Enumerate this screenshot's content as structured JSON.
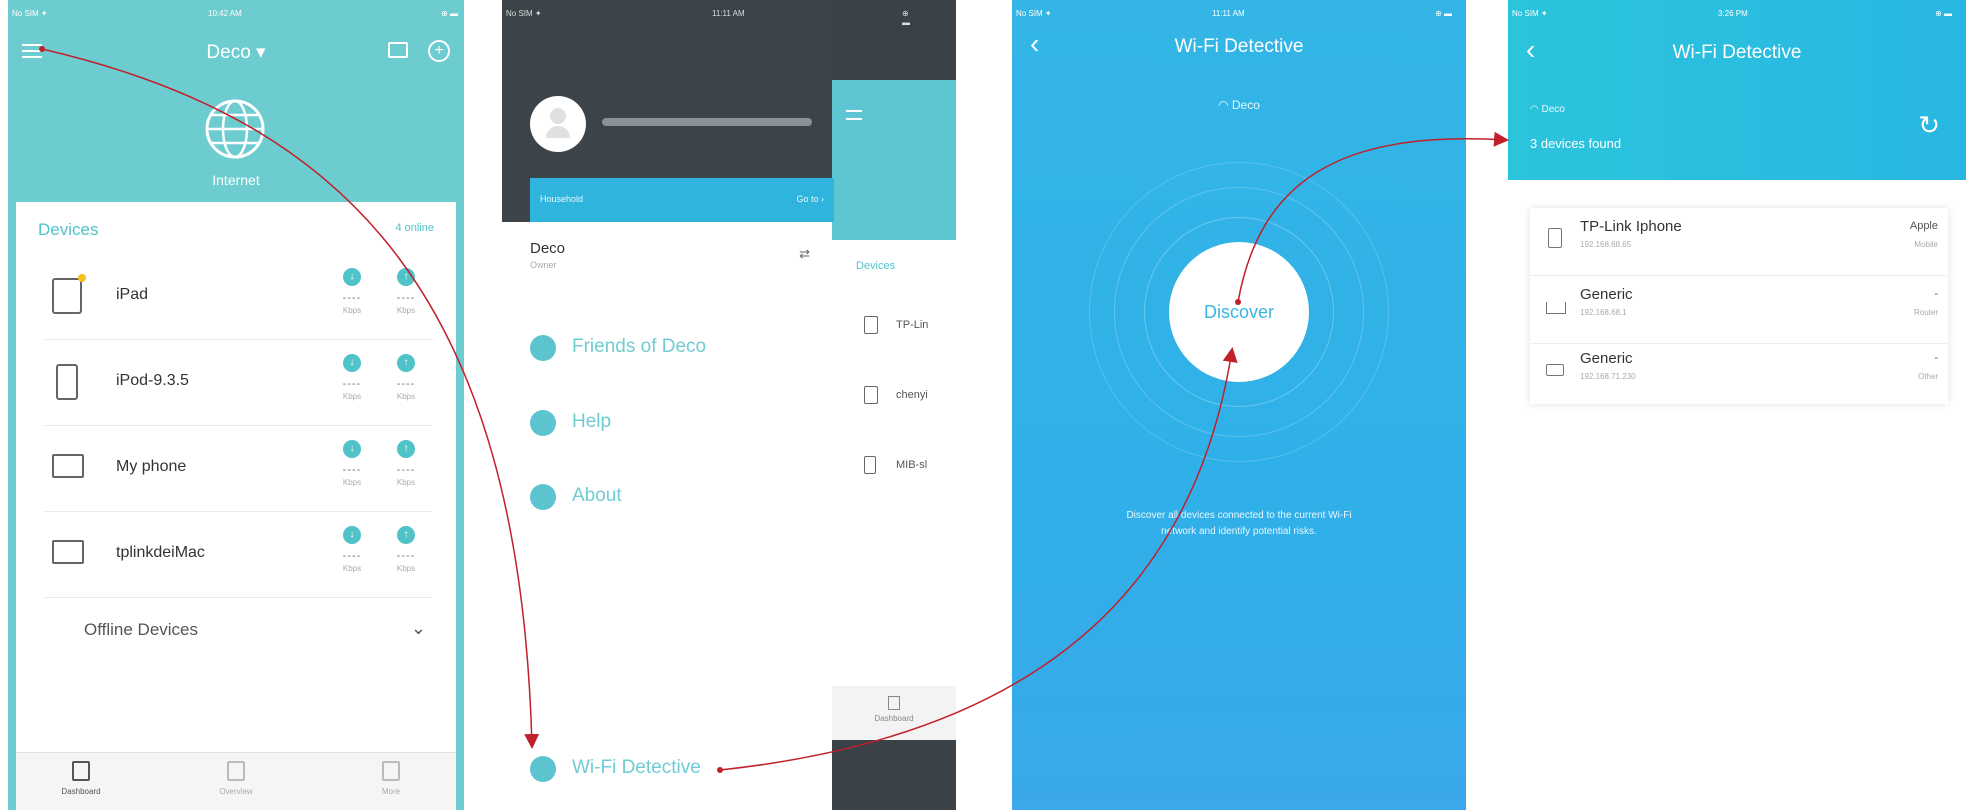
{
  "colors": {
    "teal": "#6cccd0",
    "accent": "#4fc3c8",
    "arrow": "#c0202a",
    "blue": "#2fb0e8"
  },
  "screen1": {
    "status": {
      "carrier": "No SIM ✦",
      "time": "10:42 AM",
      "battery": "⊕ ▬"
    },
    "title": "Deco ▾",
    "internet_label": "Internet",
    "devices_header": "Devices",
    "online_count": "4 online",
    "devices": [
      {
        "name": "iPad",
        "down": "----",
        "up": "----",
        "unit_down": "Kbps",
        "unit_up": "Kbps"
      },
      {
        "name": "iPod-9.3.5",
        "down": "----",
        "up": "----",
        "unit_down": "Kbps",
        "unit_up": "Kbps"
      },
      {
        "name": "My phone",
        "down": "----",
        "up": "----",
        "unit_down": "Kbps",
        "unit_up": "Kbps"
      },
      {
        "name": "tplinkdeiMac",
        "down": "----",
        "up": "----",
        "unit_down": "Kbps",
        "unit_up": "Kbps"
      }
    ],
    "offline_label": "Offline Devices",
    "tabs": [
      "Dashboard",
      "Overview",
      "More"
    ]
  },
  "screen2": {
    "status": {
      "carrier": "No SIM ✦",
      "time": "11:11 AM",
      "battery": "⊕ ▬"
    },
    "household_label": "Household",
    "household_action": "Go to ›",
    "network_name": "Deco",
    "network_role": "Owner",
    "menu": [
      "Friends of Deco",
      "Help",
      "About"
    ],
    "wifi_detective": "Wi-Fi Detective",
    "behind": {
      "devices_label": "Devices",
      "items": [
        "TP-Lin",
        "chenyi",
        "MIB-sl"
      ],
      "tab": "Dashboard"
    }
  },
  "screen3": {
    "status": {
      "carrier": "No SIM ✦",
      "time": "11:11 AM",
      "battery": "⊕ ▬"
    },
    "title": "Wi-Fi Detective",
    "network": "Deco",
    "discover": "Discover",
    "description_line1": "Discover all devices connected to the current Wi-Fi",
    "description_line2": "network and identify potential risks."
  },
  "screen4": {
    "status": {
      "carrier": "No SIM ✦",
      "time": "3:26 PM",
      "battery": "⊕ ▬"
    },
    "title": "Wi-Fi Detective",
    "network": "Deco",
    "found": "3 devices found",
    "devices": [
      {
        "name": "TP-Link Iphone",
        "ip": "192.168.68.65",
        "brand": "Apple",
        "type": "Mobile"
      },
      {
        "name": "Generic",
        "ip": "192.168.68.1",
        "brand": "-",
        "type": "Router"
      },
      {
        "name": "Generic",
        "ip": "192.168.71.230",
        "brand": "-",
        "type": "Other"
      }
    ]
  }
}
